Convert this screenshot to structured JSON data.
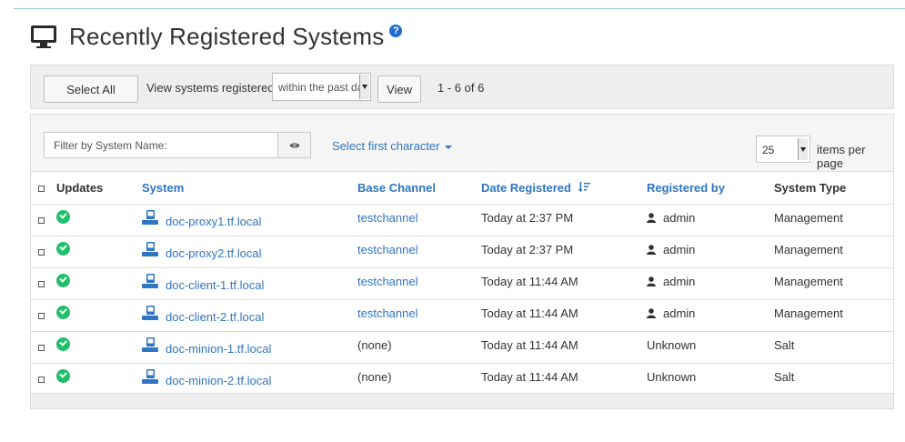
{
  "page": {
    "title": "Recently Registered Systems",
    "help_glyph": "?"
  },
  "toolbar": {
    "select_all_label": "Select All",
    "view_label_text": "View systems registered:",
    "range_selected": "within the past day",
    "view_button_label": "View",
    "range_summary": "1 - 6 of 6"
  },
  "filter": {
    "placeholder": "Filter by System Name:",
    "first_char_label": "Select first character",
    "per_page_value": "25",
    "per_page_label": "items per page"
  },
  "table": {
    "headers": {
      "updates": "Updates",
      "system": "System",
      "base_channel": "Base Channel",
      "date_registered": "Date Registered",
      "registered_by": "Registered by",
      "system_type": "System Type"
    },
    "rows": [
      {
        "system": "doc-proxy1.tf.local",
        "base_channel": "testchannel",
        "date": "Today at 2:37 PM",
        "registered_by": "admin",
        "system_type": "Management"
      },
      {
        "system": "doc-proxy2.tf.local",
        "base_channel": "testchannel",
        "date": "Today at 2:37 PM",
        "registered_by": "admin",
        "system_type": "Management"
      },
      {
        "system": "doc-client-1.tf.local",
        "base_channel": "testchannel",
        "date": "Today at 11:44 AM",
        "registered_by": "admin",
        "system_type": "Management"
      },
      {
        "system": "doc-client-2.tf.local",
        "base_channel": "testchannel",
        "date": "Today at 11:44 AM",
        "registered_by": "admin",
        "system_type": "Management"
      },
      {
        "system": "doc-minion-1.tf.local",
        "base_channel": "(none)",
        "date": "Today at 11:44 AM",
        "registered_by": "Unknown",
        "system_type": "Salt"
      },
      {
        "system": "doc-minion-2.tf.local",
        "base_channel": "(none)",
        "date": "Today at 11:44 AM",
        "registered_by": "Unknown",
        "system_type": "Salt"
      }
    ]
  },
  "colors": {
    "link": "#2f75c3",
    "status_ok": "#1fc06a",
    "help_badge": "#1d6ed0",
    "toolbar_bg": "#eeeeee"
  },
  "icons": {
    "title": "monitor-icon",
    "help": "help-icon",
    "filter_toggle": "eye-icon",
    "update_status": "checkmark-circle-icon",
    "system": "system-server-icon",
    "user": "user-icon",
    "sort": "sort-descending-icon"
  }
}
